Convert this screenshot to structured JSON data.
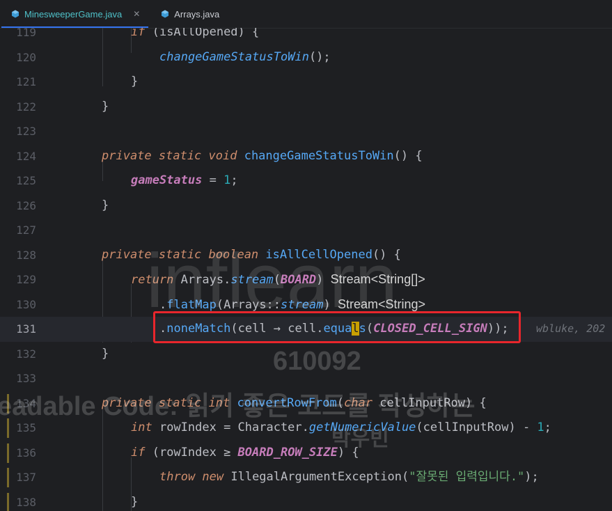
{
  "tabs": [
    {
      "label": "MinesweeperGame.java",
      "icon": "java-class-icon",
      "active": true,
      "close": "✕"
    },
    {
      "label": "Arrays.java",
      "icon": "java-class-icon",
      "active": false
    }
  ],
  "lines": [
    {
      "num": "119",
      "tokens": [
        [
          "kw",
          "if"
        ],
        [
          "",
          " (isAllOpened) {"
        ]
      ]
    },
    {
      "num": "120",
      "tokens": [
        [
          "fi",
          "changeGameStatusToWin"
        ],
        [
          "",
          "();"
        ]
      ]
    },
    {
      "num": "121",
      "tokens": [
        [
          "",
          "}"
        ]
      ]
    },
    {
      "num": "122",
      "tokens": [
        [
          "",
          "}"
        ]
      ]
    },
    {
      "num": "123",
      "tokens": []
    },
    {
      "num": "124",
      "tokens": [
        [
          "kw",
          "private static void "
        ],
        [
          "fn",
          "changeGameStatusToWin"
        ],
        [
          "",
          "() {"
        ]
      ]
    },
    {
      "num": "125",
      "tokens": [
        [
          "cst",
          "gameStatus"
        ],
        [
          "",
          " = "
        ],
        [
          "num",
          "1"
        ],
        [
          "",
          ";"
        ]
      ]
    },
    {
      "num": "126",
      "tokens": [
        [
          "",
          "}"
        ]
      ]
    },
    {
      "num": "127",
      "tokens": []
    },
    {
      "num": "128",
      "tokens": [
        [
          "kw",
          "private static boolean "
        ],
        [
          "fn",
          "isAllCellOpened"
        ],
        [
          "",
          "() {"
        ]
      ]
    },
    {
      "num": "129",
      "tokens": [
        [
          "kw",
          "return "
        ],
        [
          "",
          "Arrays."
        ],
        [
          "fi",
          "stream"
        ],
        [
          "",
          "("
        ],
        [
          "cst",
          "BOARD"
        ],
        [
          "",
          ") "
        ],
        [
          "hint",
          "Stream<String[]>"
        ]
      ]
    },
    {
      "num": "130",
      "tokens": [
        [
          "",
          "."
        ],
        [
          "fn",
          "flatMap"
        ],
        [
          "",
          "(Arrays::"
        ],
        [
          "fi",
          "stream"
        ],
        [
          "",
          ") "
        ],
        [
          "hint",
          "Stream<String>"
        ]
      ]
    },
    {
      "num": "131",
      "tokens": [
        [
          "",
          "."
        ],
        [
          "fn",
          "noneMatch"
        ],
        [
          "",
          "(cell → cell."
        ],
        [
          "fn",
          "equa"
        ],
        [
          "cursor",
          "l"
        ],
        [
          "fn",
          "s"
        ],
        [
          "",
          "("
        ],
        [
          "cst",
          "CLOSED_CELL_SIGN"
        ],
        [
          "",
          "));"
        ]
      ]
    },
    {
      "num": "132",
      "tokens": [
        [
          "",
          "}"
        ]
      ]
    },
    {
      "num": "133",
      "tokens": []
    },
    {
      "num": "134",
      "tokens": [
        [
          "kw",
          "private static int "
        ],
        [
          "fn",
          "convertRowFrom"
        ],
        [
          "",
          "("
        ],
        [
          "kw",
          "char "
        ],
        [
          "",
          "cellInputRow) {"
        ]
      ]
    },
    {
      "num": "135",
      "tokens": [
        [
          "tp",
          "int "
        ],
        [
          "",
          "rowIndex = Character."
        ],
        [
          "fi",
          "getNumericValue"
        ],
        [
          "",
          "(cellInputRow) - "
        ],
        [
          "num",
          "1"
        ],
        [
          "",
          ";"
        ]
      ]
    },
    {
      "num": "136",
      "tokens": [
        [
          "kw",
          "if "
        ],
        [
          "",
          "(rowIndex ≥ "
        ],
        [
          "cst",
          "BOARD_ROW_SIZE"
        ],
        [
          "",
          ") {"
        ]
      ]
    },
    {
      "num": "137",
      "tokens": [
        [
          "kw",
          "throw new "
        ],
        [
          "",
          "IllegalArgumentException("
        ],
        [
          "str",
          "\"잘못된 입력입니다.\""
        ],
        [
          "",
          ");"
        ]
      ]
    },
    {
      "num": "138",
      "tokens": [
        [
          "",
          "}"
        ]
      ]
    }
  ],
  "blame": "wbluke, 202",
  "watermark": {
    "logo": "inflearn",
    "id": "610092",
    "course": "eadable Code: 읽기 좋은 코드를 작성하는",
    "author": "박우빈"
  }
}
